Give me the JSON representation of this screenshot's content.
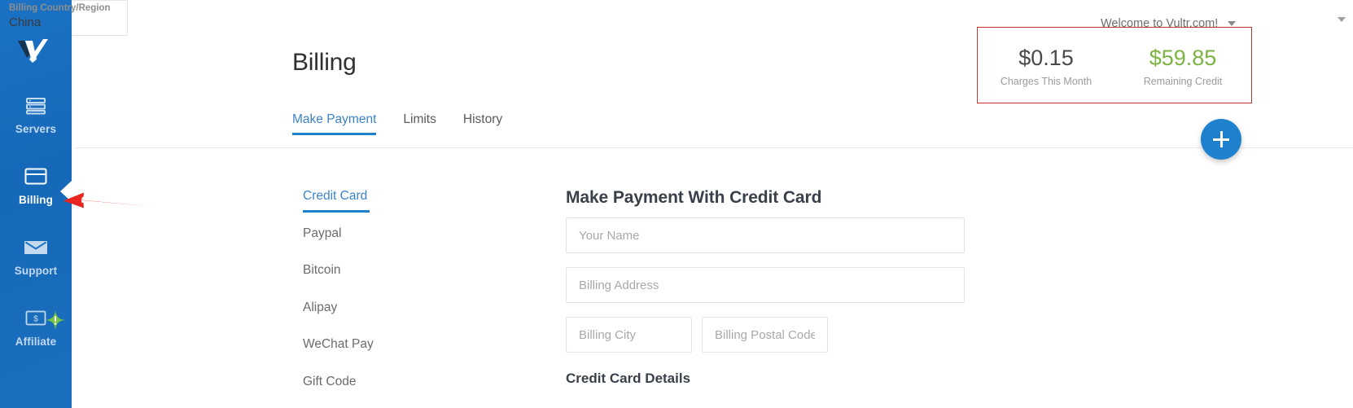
{
  "sidebar": {
    "logo": "vultr-logo",
    "items": [
      {
        "label": "Servers",
        "icon": "servers-icon",
        "active": false
      },
      {
        "label": "Billing",
        "icon": "credit-card-icon",
        "active": true
      },
      {
        "label": "Support",
        "icon": "envelope-icon",
        "active": false
      },
      {
        "label": "Affiliate",
        "icon": "dollar-bill-icon",
        "active": false,
        "badge": "!"
      }
    ]
  },
  "topbar": {
    "welcome": "Welcome to Vultr.com!",
    "caret_icon": "chevron-down-icon"
  },
  "balance": {
    "charges_amount": "$0.15",
    "charges_caption": "Charges This Month",
    "credit_amount": "$59.85",
    "credit_caption": "Remaining Credit",
    "highlight_color": "#c0392b",
    "credit_color": "#7cb342"
  },
  "page": {
    "title": "Billing"
  },
  "tabs": [
    {
      "label": "Make Payment",
      "active": true
    },
    {
      "label": "Limits",
      "active": false
    },
    {
      "label": "History",
      "active": false
    }
  ],
  "fab": {
    "icon": "plus-icon",
    "color": "#1e81ce"
  },
  "methods": [
    {
      "label": "Credit Card",
      "active": true
    },
    {
      "label": "Paypal",
      "active": false
    },
    {
      "label": "Bitcoin",
      "active": false
    },
    {
      "label": "Alipay",
      "active": false
    },
    {
      "label": "WeChat Pay",
      "active": false
    },
    {
      "label": "Gift Code",
      "active": false
    }
  ],
  "form": {
    "heading": "Make Payment With Credit Card",
    "name_placeholder": "Your Name",
    "name_value": "",
    "address_placeholder": "Billing Address",
    "address_value": "",
    "city_placeholder": "Billing City",
    "city_value": "",
    "postal_placeholder": "Billing Postal Code",
    "postal_value": "",
    "country_label": "Billing Country/Region",
    "country_value": "China",
    "country_caret_icon": "chevron-down-icon",
    "card_details_heading": "Credit Card Details"
  },
  "annotation": {
    "arrow": "red-arrow-pointing-left",
    "color": "#e8251f"
  }
}
